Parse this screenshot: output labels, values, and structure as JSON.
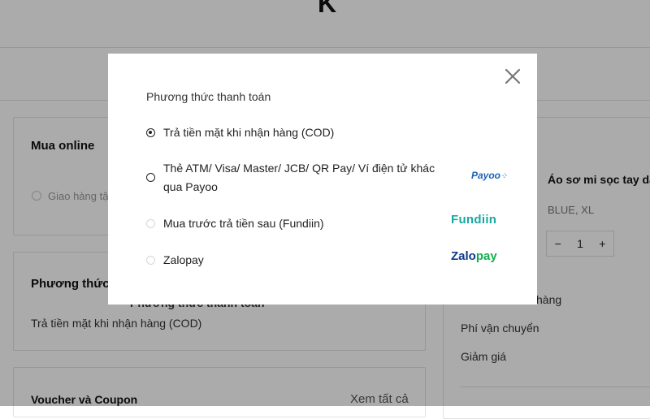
{
  "brand": {
    "logo_letter": "K"
  },
  "background": {
    "online_card": {
      "title": "Mua online",
      "shipping_option": "Giao hàng tận"
    },
    "payment_card": {
      "title": "Phương thức t",
      "peek_text": "Phương thức thanh toán",
      "selected_value": "Trả tiền mặt khi nhận hàng (COD)"
    },
    "voucher_card": {
      "title": "Voucher và Coupon",
      "view_all": "Xem tất cả"
    },
    "product": {
      "name": "Áo sơ mi sọc tay dài t",
      "variant": "BLUE, XL",
      "qty_minus": "−",
      "qty_value": "1",
      "qty_plus": "+"
    },
    "summary": {
      "subtotal_label": "hàng",
      "shipping_label": "Phí vận chuyển",
      "discount_label": "Giảm giá"
    }
  },
  "modal": {
    "title": "Phương thức thanh toán",
    "close_icon": "close-icon",
    "options": [
      {
        "label": "Trả tiền mặt khi nhận hàng (COD)",
        "state": "checked",
        "logo": ""
      },
      {
        "label": "Thẻ ATM/ Visa/ Master/ JCB/ QR Pay/ Ví điện tử khác qua Payoo",
        "state": "unchecked",
        "logo": "Payoo"
      },
      {
        "label": "Mua trước trả tiền sau (Fundiin)",
        "state": "disabled",
        "logo": "Fundiin"
      },
      {
        "label": "Zalopay",
        "state": "disabled",
        "logo_parts": [
          "Zalo",
          "pay"
        ]
      }
    ]
  },
  "colors": {
    "overlay": "rgba(0,0,0,0.33)",
    "payoo_blue": "#1e64b4",
    "fundiin_teal": "#18a8a0",
    "zalo_blue": "#0b3b8c",
    "zalo_green": "#10b04c"
  }
}
